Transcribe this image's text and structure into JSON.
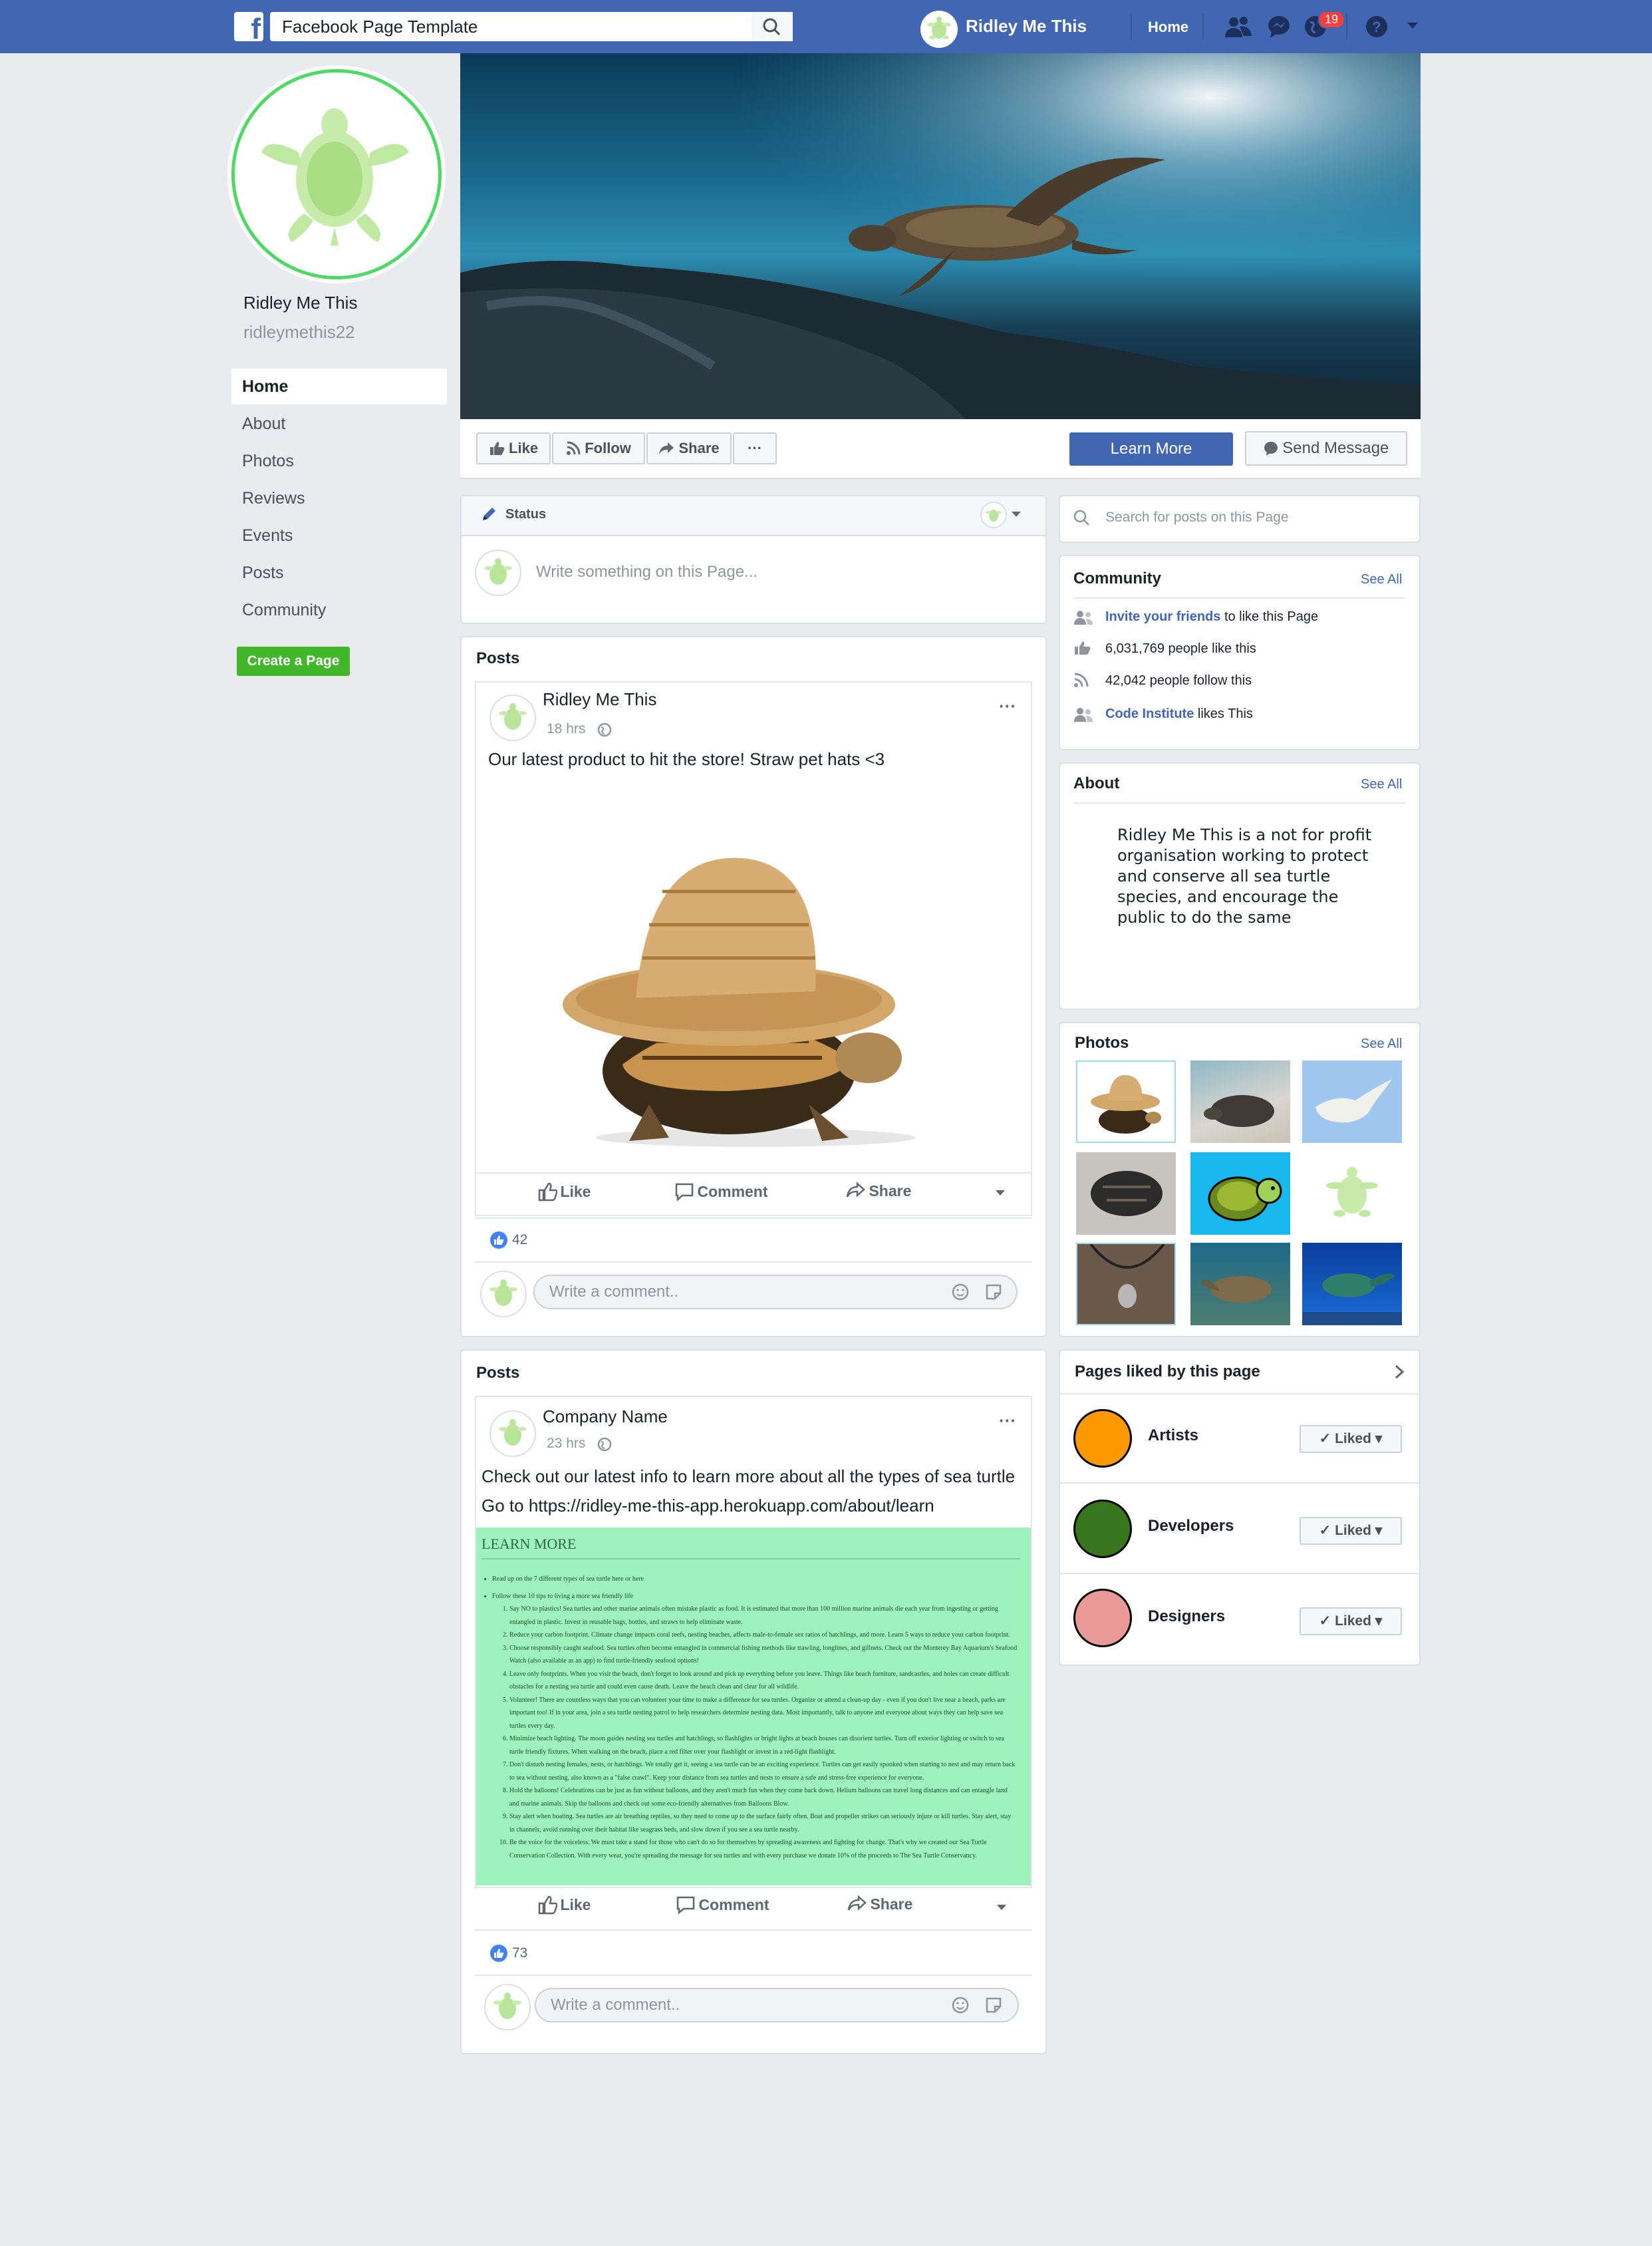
{
  "topbar": {
    "search_value": "Facebook Page Template",
    "page_name": "Ridley Me This",
    "home": "Home",
    "notification_count": "19"
  },
  "profile": {
    "name": "Ridley Me This",
    "handle": "ridleymethis22"
  },
  "nav": {
    "items": [
      "Home",
      "About",
      "Photos",
      "Reviews",
      "Events",
      "Posts",
      "Community"
    ],
    "create_page": "Create a Page"
  },
  "actions": {
    "like": "Like",
    "follow": "Follow",
    "share": "Share",
    "more": "···",
    "learn_more": "Learn More",
    "send_message": "Send Message"
  },
  "composer": {
    "status": "Status",
    "placeholder": "Write something on this Page..."
  },
  "posts": [
    {
      "section": "Posts",
      "author": "Ridley Me This",
      "time": "18 hrs",
      "text": "Our latest product to hit the store! Straw pet hats <3",
      "like_label": "Like",
      "comment_label": "Comment",
      "share_label": "Share",
      "reactions": "42",
      "comment_placeholder": "Write a comment.."
    },
    {
      "section": "Posts",
      "author": "Company Name",
      "time": "23 hrs",
      "text_line1": "Check out our latest info to learn more about all the types of sea turtle",
      "text_line2": "Go to https://ridley-me-this-app.herokuapp.com/about/learn",
      "learn_heading": "LEARN MORE",
      "learn_intro": "Read up on the 7 different types of sea turtle here or here",
      "learn_follow": "Follow these 10 tips to living a more sea friendly life",
      "learn_tips": [
        "Say NO to plastics! Sea turtles and other marine animals often mistake plastic as food. It is estimated that more than 100 million marine animals die each year from ingesting or getting entangled in plastic. Invest in reusable bags, bottles, and straws to help eliminate waste.",
        "Reduce your carbon footprint. Climate change impacts coral reefs, nesting beaches, affects male-to-female sex ratios of hatchlings, and more. Learn 5 ways to reduce your carbon footprint.",
        "Choose responsibly caught seafood. Sea turtles often become entangled in commercial fishing methods like trawling, longlines, and gillnets. Check out the Monterey Bay Aquarium's Seafood Watch (also available as an app) to find turtle-friendly seafood options!",
        "Leave only footprints. When you visit the beach, don't forget to look around and pick up everything before you leave. Things like beach furniture, sandcastles, and holes can create difficult obstacles for a nesting sea turtle and could even cause death. Leave the beach clean and clear for all wildlife.",
        "Volunteer! There are countless ways that you can volunteer your time to make a difference for sea turtles. Organize or attend a clean-up day - even if you don't live near a beach, parks are important too! If in your area, join a sea turtle nesting patrol to help researchers determine nesting data. Most importantly, talk to anyone and everyone about ways they can help save sea turtles every day.",
        "Minimize beach lighting. The moon guides nesting sea turtles and hatchlings, so flashlights or bright lights at beach houses can disorient turtles. Turn off exterior lighting or switch to sea turtle friendly fixtures. When walking on the beach, place a red filter over your flashlight or invest in a red-light flashlight.",
        "Don't disturb nesting females, nests, or hatchlings. We totally get it, seeing a sea turtle can be an exciting experience. Turtles can get easily spooked when starting to nest and may return back to sea without nesting, also known as a \"false crawl\". Keep your distance from sea turtles and nests to ensure a safe and stress-free experience for everyone.",
        "Hold the balloons! Celebrations can be just as fun without balloons, and they aren't much fun when they come back down. Helium balloons can travel long distances and can entangle land and marine animals. Skip the balloons and check out some eco-friendly alternatives from Balloons Blow.",
        "Stay alert when boating. Sea turtles are air breathing reptiles, so they need to come up to the surface fairly often. Boat and propeller strikes can seriously injure or kill turtles. Stay alert, stay in channels, avoid running over their habitat like seagrass beds, and slow down if you see a sea turtle nearby.",
        "Be the voice for the voiceless. We must take a stand for those who can't do so for themselves by spreading awareness and fighting for change. That's why we created our Sea Turtle Conservation Collection. With every wear, you're spreading the message for sea turtles and with every purchase we donate 10% of the proceeds to The Sea Turtle Conservancy."
      ],
      "like_label": "Like",
      "comment_label": "Comment",
      "share_label": "Share",
      "reactions": "73",
      "comment_placeholder": "Write a comment.."
    }
  ],
  "sidebar": {
    "search_placeholder": "Search for posts on this Page",
    "community": {
      "title": "Community",
      "see_all": "See All",
      "invite_link": "Invite your friends",
      "invite_rest": "to like this Page",
      "likes": "6,031,769 people like this",
      "follows": "42,042 people follow this",
      "ci_link": "Code Institute",
      "ci_rest": "likes This"
    },
    "about": {
      "title": "About",
      "see_all": "See All",
      "lines": [
        "Ridley Me This is a not for profit",
        "organisation working to protect",
        "and conserve all sea turtle",
        "species, and encourage the",
        "public to do the same"
      ]
    },
    "photos": {
      "title": "Photos",
      "see_all": "See All"
    },
    "pages_liked": {
      "title": "Pages liked by this page",
      "items": [
        {
          "name": "Artists",
          "color": "#ff9900",
          "button": "Liked"
        },
        {
          "name": "Developers",
          "color": "#38761d",
          "button": "Liked"
        },
        {
          "name": "Designers",
          "color": "#ea9999",
          "button": "Liked"
        }
      ]
    }
  },
  "colors": {
    "facebook_blue": "#4267b2",
    "page_bg": "#e9ebee",
    "profile_ring": "#4cd964",
    "learn_bg": "#9ef2bb",
    "create_green": "#42b72a"
  }
}
